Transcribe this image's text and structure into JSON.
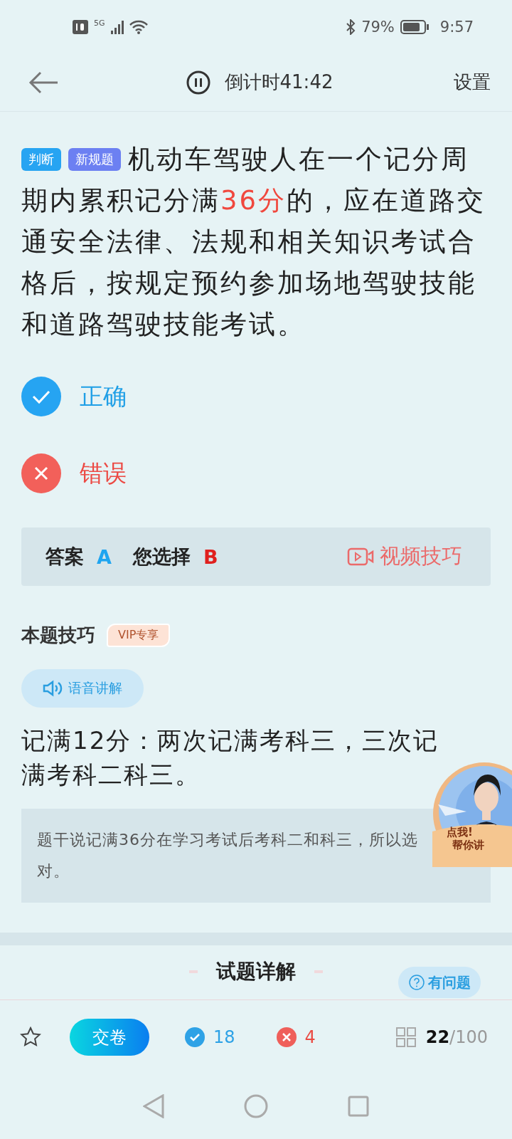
{
  "status_bar": {
    "signal_label": "5G",
    "battery": "79%",
    "time": "9:57"
  },
  "header": {
    "timer": "倒计时41:42",
    "settings": "设置"
  },
  "question": {
    "tags": [
      {
        "label": "判断",
        "color": "#27a4f2"
      },
      {
        "label": "新规题",
        "color": "#6c80f2"
      }
    ],
    "parts": [
      {
        "text": "机动车驾驶人在一个记分周期内累积记分满",
        "highlight": false
      },
      {
        "text": "36分",
        "highlight": true
      },
      {
        "text": "的，应在道路交通安全法律、法规和相关知识考试合格后，按规定预约参加场地驾驶技能和道路驾驶技能考试。",
        "highlight": false
      }
    ]
  },
  "options": [
    {
      "kind": "right",
      "label": "正确"
    },
    {
      "kind": "wrong",
      "label": "错误"
    }
  ],
  "answer": {
    "label": "答案",
    "value": "A",
    "choice_label": "您选择",
    "choice": "B",
    "video": "视频技巧"
  },
  "tips": {
    "title": "本题技巧",
    "badge": "VIP专享",
    "audio": "语音讲解",
    "summary": "记满12分：两次记满考科三，三次记满考科二科三。",
    "note": "题干说记满36分在学习考试后考科二和科三，所以选对。"
  },
  "promo": {
    "kind": "picture",
    "line_1": "点我!",
    "line_2": "帮你讲"
  },
  "details": {
    "title": "试题详解",
    "help": "有问题"
  },
  "bottom_bar": {
    "submit": "交卷",
    "right_count": "18",
    "wrong_count": "4",
    "current": "22",
    "total": "/100"
  }
}
